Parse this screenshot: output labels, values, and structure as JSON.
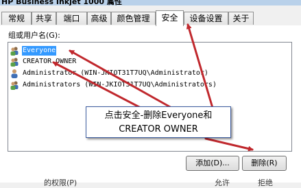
{
  "window": {
    "title": "HP Business Inkjet 1000 属性"
  },
  "tabs": [
    {
      "label": "常规",
      "active": false
    },
    {
      "label": "共享",
      "active": false
    },
    {
      "label": "端口",
      "active": false
    },
    {
      "label": "高级",
      "active": false
    },
    {
      "label": "颜色管理",
      "active": false
    },
    {
      "label": "安全",
      "active": true
    },
    {
      "label": "设备设置",
      "active": false
    },
    {
      "label": "关于",
      "active": false
    }
  ],
  "security": {
    "group_label": "组或用户名(G):",
    "users": [
      {
        "name": "Everyone",
        "icon": "group-icon",
        "selected": true
      },
      {
        "name": "CREATOR OWNER",
        "icon": "group-icon",
        "selected": false
      },
      {
        "name": "Administrator (WIN-JKIOT31T7UQ\\Administrator)",
        "icon": "user-icon",
        "selected": false
      },
      {
        "name": "Administrators (WIN-JKIOT31T7UQ\\Administrators)",
        "icon": "group-icon",
        "selected": false
      }
    ],
    "add_button": "添加(D)...",
    "remove_button": "删除(R)",
    "permissions_header": "的权限(P)",
    "allow_header": "允许",
    "deny_header": "拒绝"
  },
  "annotation": {
    "line1": "点击安全-删除Everyone和",
    "line2": "CREATOR OWNER",
    "color": "#c0282d"
  }
}
